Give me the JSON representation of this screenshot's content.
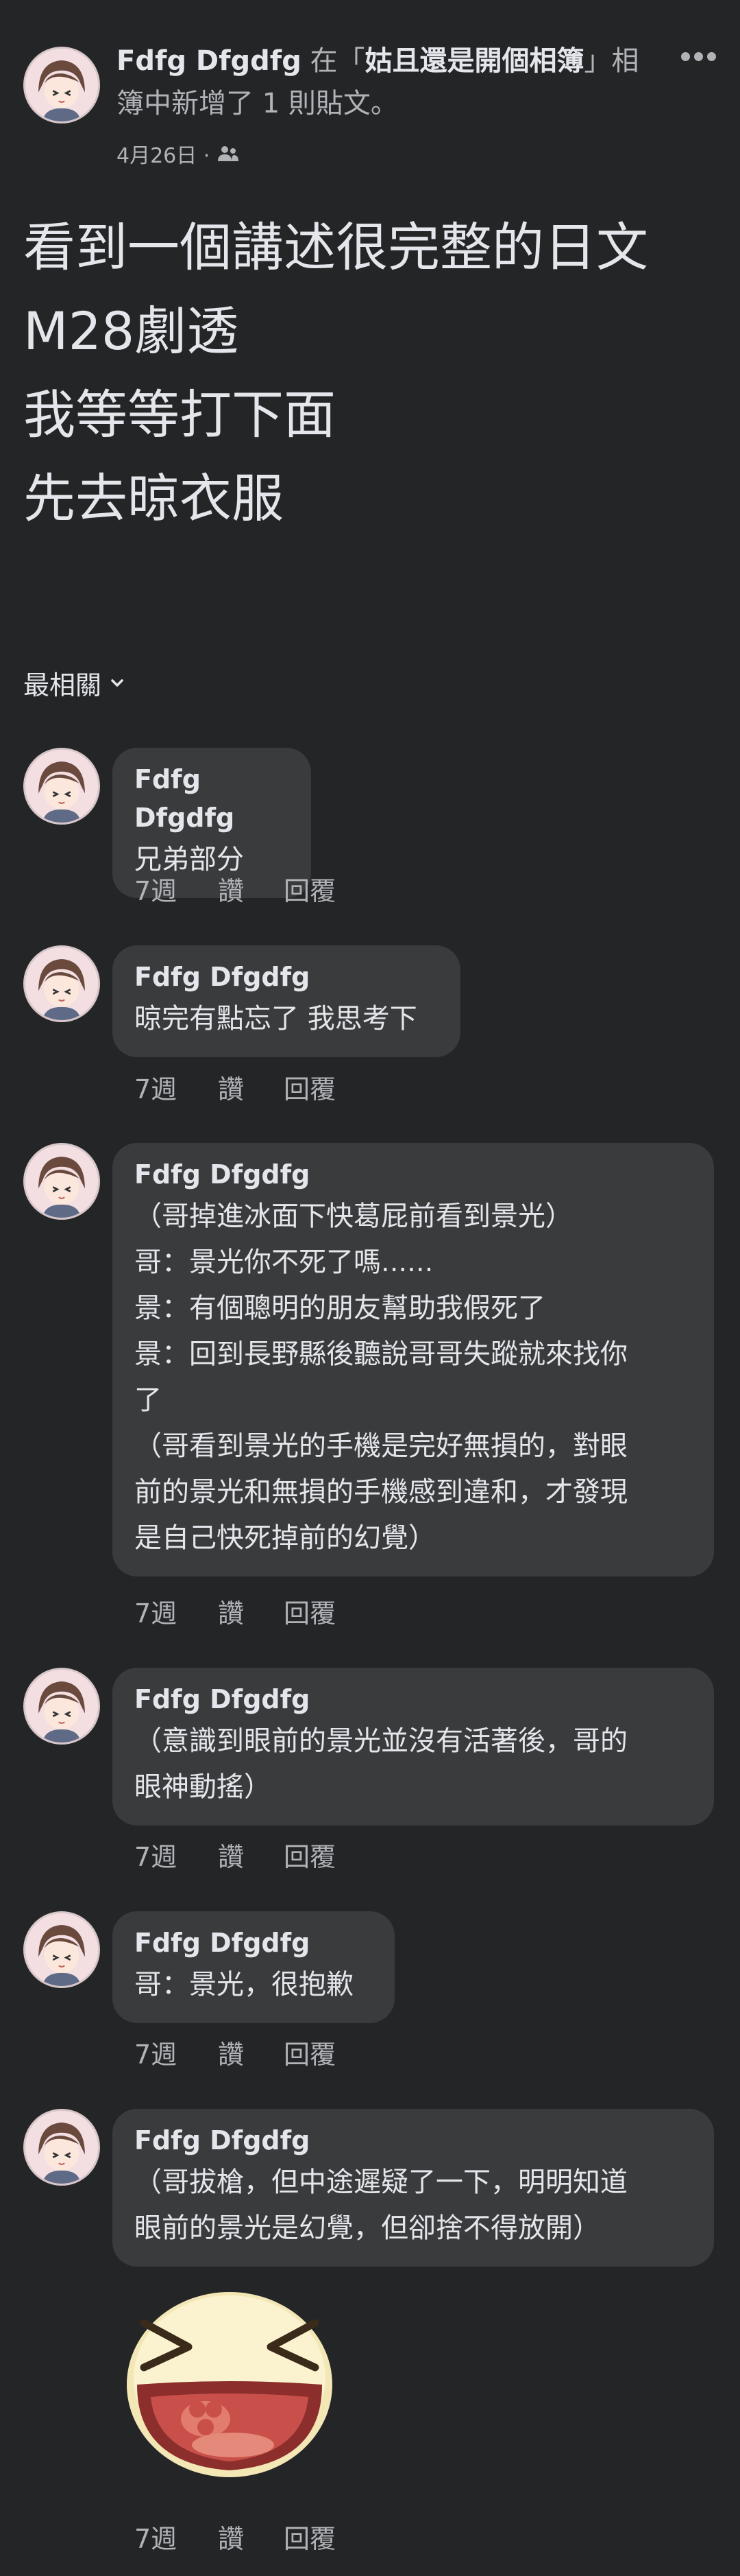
{
  "post": {
    "author": "Fdfg Dfgdfg",
    "header_pre": " 在「",
    "album": "姑且還是開個相簿",
    "header_post": "」相簿中新增了 1 則貼文。",
    "date": "4月26日 ·",
    "privacy_icon": "friends-icon",
    "lines": [
      "看到一個講述很完整的日文",
      "M28劇透",
      "我等等打下面",
      "先去晾衣服"
    ]
  },
  "sort": {
    "label": "最相關"
  },
  "actions": {
    "time": "7週",
    "like": "讚",
    "reply": "回覆"
  },
  "comments": [
    {
      "author": "Fdfg Dfgdfg",
      "lines": [
        "兄弟部分"
      ]
    },
    {
      "author": "Fdfg Dfgdfg",
      "lines": [
        "晾完有點忘了 我思考下"
      ]
    },
    {
      "author": "Fdfg Dfgdfg",
      "lines": [
        "（哥掉進冰面下快葛屁前看到景光）",
        "哥：景光你不死了嗎......",
        "景：有個聰明的朋友幫助我假死了",
        "景：回到長野縣後聽說哥哥失蹤就來找你",
        "了",
        "（哥看到景光的手機是完好無損的，對眼",
        "前的景光和無損的手機感到違和，才發現",
        "是自己快死掉前的幻覺）"
      ]
    },
    {
      "author": "Fdfg Dfgdfg",
      "lines": [
        "（意識到眼前的景光並沒有活著後，哥的",
        "眼神動搖）"
      ]
    },
    {
      "author": "Fdfg Dfgdfg",
      "lines": [
        "哥：景光，很抱歉"
      ]
    },
    {
      "author": "Fdfg Dfgdfg",
      "lines": [
        "（哥拔槍，但中途遲疑了一下，明明知道",
        "眼前的景光是幻覺，但卻捨不得放開）"
      ]
    }
  ],
  "colors": {
    "background": "#242526",
    "bubble": "#3a3b3c",
    "text": "#e4e6eb",
    "secondary": "#b0b3b8"
  }
}
